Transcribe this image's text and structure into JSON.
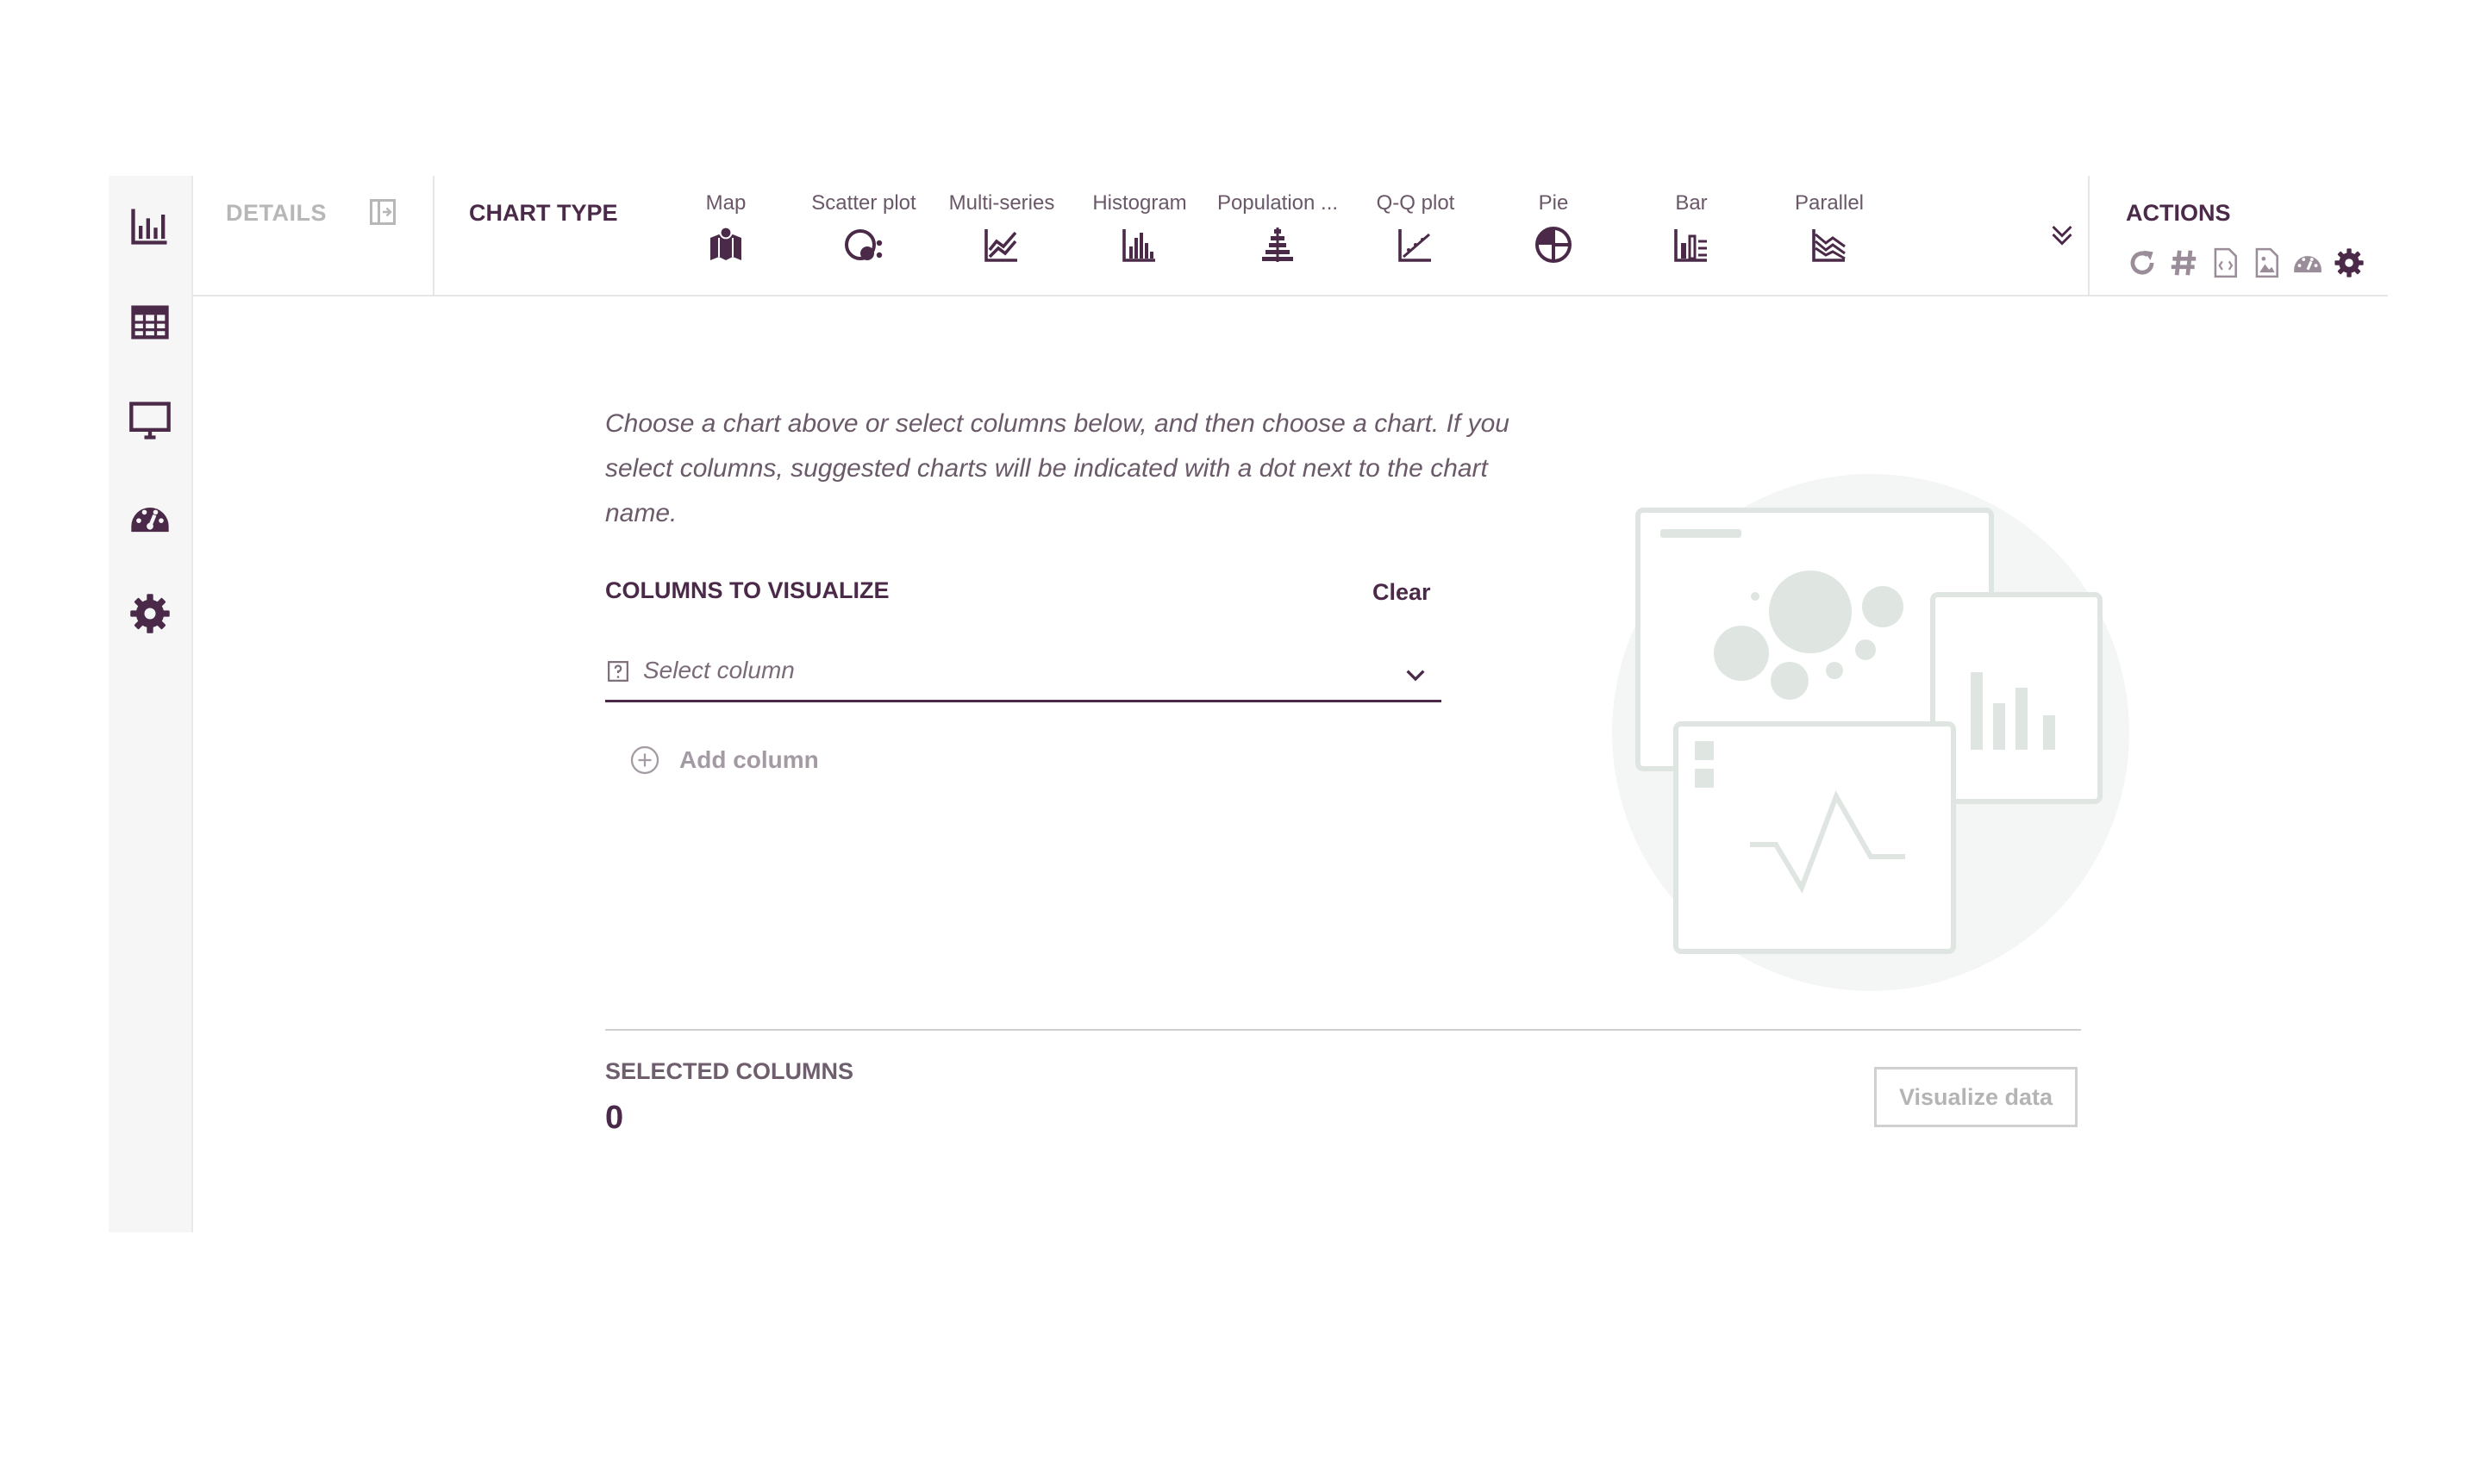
{
  "rail": {
    "items": [
      {
        "icon": "bar-chart-icon"
      },
      {
        "icon": "table-icon"
      },
      {
        "icon": "monitor-icon"
      },
      {
        "icon": "dashboard-gauge-icon"
      },
      {
        "icon": "gear-icon"
      }
    ]
  },
  "toolbar": {
    "details_label": "DETAILS",
    "chart_type_label": "CHART TYPE",
    "chart_types": [
      {
        "label": "Map",
        "icon": "map-icon"
      },
      {
        "label": "Scatter plot",
        "icon": "scatter-plot-icon"
      },
      {
        "label": "Multi-series",
        "icon": "multi-series-icon"
      },
      {
        "label": "Histogram",
        "icon": "histogram-icon"
      },
      {
        "label": "Population ...",
        "icon": "population-pyramid-icon"
      },
      {
        "label": "Q-Q plot",
        "icon": "qq-plot-icon"
      },
      {
        "label": "Pie",
        "icon": "pie-icon"
      },
      {
        "label": "Bar",
        "icon": "bar-icon"
      },
      {
        "label": "Parallel",
        "icon": "parallel-icon"
      }
    ],
    "actions_label": "ACTIONS",
    "actions": [
      "refresh-icon",
      "hash-icon",
      "code-file-icon",
      "image-file-icon",
      "dashboard-icon",
      "settings-icon"
    ]
  },
  "main": {
    "intro": "Choose a chart above or select columns below, and then choose a chart. If you select columns, suggested charts will be indicated with a dot next to the chart name.",
    "columns_title": "COLUMNS TO VISUALIZE",
    "clear_label": "Clear",
    "select_placeholder": "Select column",
    "add_column_label": "Add column",
    "selected_columns_title": "SELECTED COLUMNS",
    "selected_count": "0",
    "visualize_label": "Visualize data"
  },
  "colors": {
    "accent": "#4a2a48",
    "muted": "#b7b7b7",
    "illustration": "#dfe6e1"
  }
}
